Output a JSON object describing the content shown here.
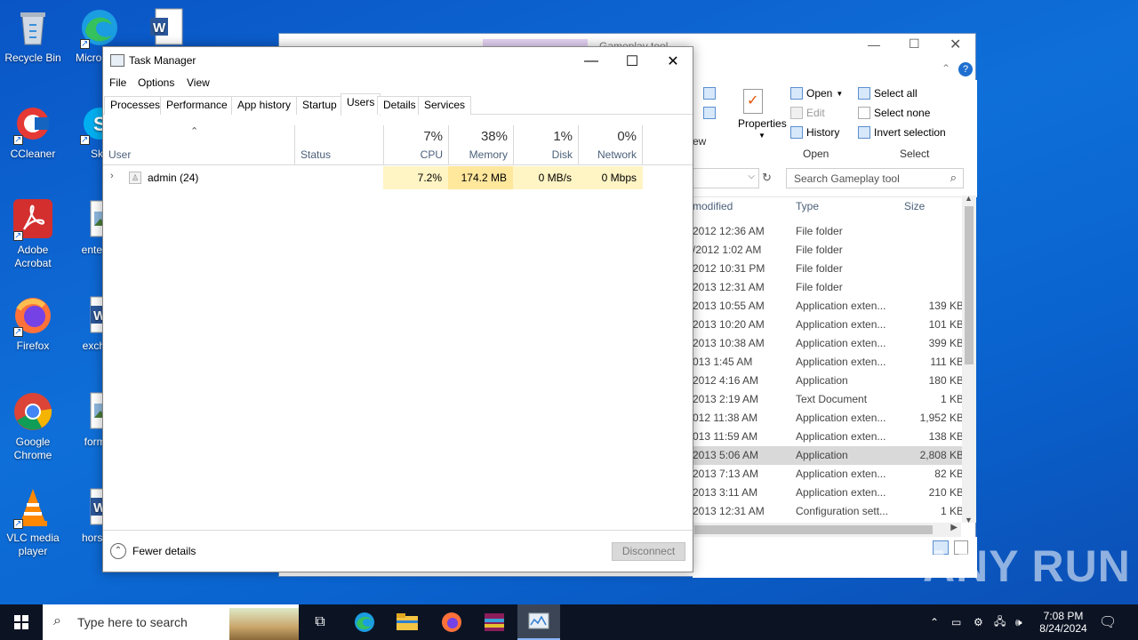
{
  "desktop": {
    "icons": [
      {
        "label": "Recycle Bin"
      },
      {
        "label": "Micro Edg"
      },
      {
        "label": ""
      },
      {
        "label": "CCleaner"
      },
      {
        "label": "Sky"
      },
      {
        "label": "Adobe Acrobat"
      },
      {
        "label": "enterbe"
      },
      {
        "label": "Firefox"
      },
      {
        "label": "exchan"
      },
      {
        "label": "Google Chrome"
      },
      {
        "label": "former"
      },
      {
        "label": "VLC media player"
      },
      {
        "label": "horsem"
      }
    ]
  },
  "explorer": {
    "title_fragment": "Gameplay tool",
    "ribbon": {
      "properties_label": "Properties",
      "open_label": "Open",
      "edit_label": "Edit",
      "history_label": "History",
      "select_all_label": "Select all",
      "select_none_label": "Select none",
      "invert_selection_label": "Invert selection",
      "group_view_label": "ew",
      "group_open_label": "Open",
      "group_select_label": "Select"
    },
    "search_placeholder": "Search Gameplay tool",
    "columns": {
      "modified": "modified",
      "type": "Type",
      "size": "Size"
    },
    "rows": [
      {
        "date": "2012 12:36 AM",
        "type": "File folder",
        "size": ""
      },
      {
        "date": "/2012 1:02 AM",
        "type": "File folder",
        "size": ""
      },
      {
        "date": "2012 10:31 PM",
        "type": "File folder",
        "size": ""
      },
      {
        "date": "2013 12:31 AM",
        "type": "File folder",
        "size": ""
      },
      {
        "date": "2013 10:55 AM",
        "type": "Application exten...",
        "size": "139 KB"
      },
      {
        "date": "2013 10:20 AM",
        "type": "Application exten...",
        "size": "101 KB"
      },
      {
        "date": "2013 10:38 AM",
        "type": "Application exten...",
        "size": "399 KB"
      },
      {
        "date": "013 1:45 AM",
        "type": "Application exten...",
        "size": "111 KB"
      },
      {
        "date": "2012 4:16 AM",
        "type": "Application",
        "size": "180 KB"
      },
      {
        "date": "2013 2:19 AM",
        "type": "Text Document",
        "size": "1 KB"
      },
      {
        "date": "012 11:38 AM",
        "type": "Application exten...",
        "size": "1,952 KB"
      },
      {
        "date": "013 11:59 AM",
        "type": "Application exten...",
        "size": "138 KB"
      },
      {
        "date": "2013 5:06 AM",
        "type": "Application",
        "size": "2,808 KB"
      },
      {
        "date": "2013 7:13 AM",
        "type": "Application exten...",
        "size": "82 KB"
      },
      {
        "date": "2013 3:11 AM",
        "type": "Application exten...",
        "size": "210 KB"
      },
      {
        "date": "2013 12:31 AM",
        "type": "Configuration sett...",
        "size": "1 KB"
      }
    ]
  },
  "task_manager": {
    "title": "Task Manager",
    "menu": {
      "file": "File",
      "options": "Options",
      "view": "View"
    },
    "tabs": [
      "Processes",
      "Performance",
      "App history",
      "Startup",
      "Users",
      "Details",
      "Services"
    ],
    "active_tab": "Users",
    "columns": {
      "user": "User",
      "status": "Status",
      "cpu": {
        "pct": "7%",
        "label": "CPU"
      },
      "memory": {
        "pct": "38%",
        "label": "Memory"
      },
      "disk": {
        "pct": "1%",
        "label": "Disk"
      },
      "network": {
        "pct": "0%",
        "label": "Network"
      }
    },
    "users": [
      {
        "name": "admin (24)",
        "status": "",
        "cpu": "7.2%",
        "memory": "174.2 MB",
        "disk": "0 MB/s",
        "network": "0 Mbps"
      }
    ],
    "fewer_details_label": "Fewer details",
    "disconnect_label": "Disconnect"
  },
  "watermark": "ANY RUN",
  "taskbar": {
    "search_placeholder": "Type here to search",
    "time": "7:08 PM",
    "date": "8/24/2024"
  }
}
